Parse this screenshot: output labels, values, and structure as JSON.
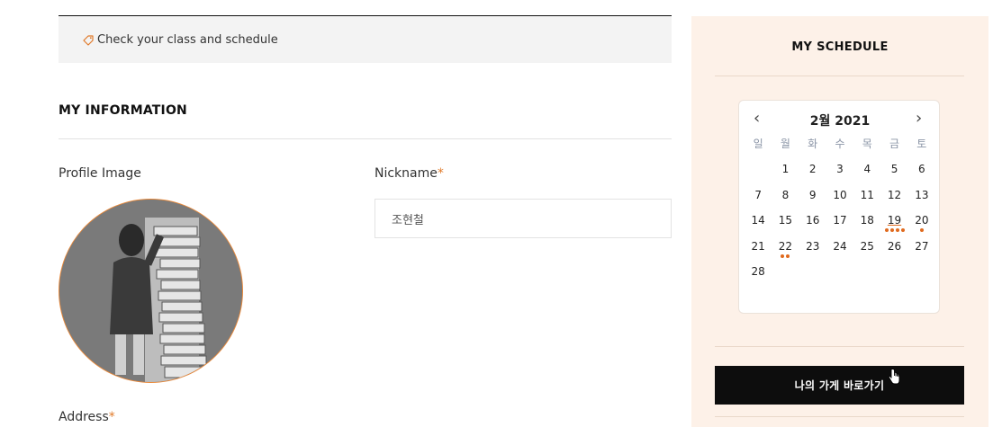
{
  "notice": {
    "text": "Check your class and schedule"
  },
  "my_info": {
    "title": "MY INFORMATION",
    "profile_label": "Profile Image",
    "nickname_label": "Nickname",
    "nickname_required": "*",
    "nickname_value": "조현철",
    "address_label": "Address",
    "address_required": "*"
  },
  "schedule": {
    "title": "MY SCHEDULE",
    "month_label": "2월 2021",
    "weekdays": [
      "일",
      "월",
      "화",
      "수",
      "목",
      "금",
      "토"
    ],
    "weeks": [
      [
        "",
        "1",
        "2",
        "3",
        "4",
        "5",
        "6"
      ],
      [
        "7",
        "8",
        "9",
        "10",
        "11",
        "12",
        "13"
      ],
      [
        "14",
        "15",
        "16",
        "17",
        "18",
        "19",
        "20"
      ],
      [
        "21",
        "22",
        "23",
        "24",
        "25",
        "26",
        "27"
      ],
      [
        "28",
        "",
        "",
        "",
        "",
        "",
        ""
      ]
    ],
    "events": {
      "19": 4,
      "20": 1,
      "22": 2
    },
    "event_color": "#e06a1e",
    "prev_icon": "chevron-left-icon",
    "next_icon": "chevron-right-icon"
  },
  "shop_button": {
    "label": "나의 가게 바로가기"
  },
  "colors": {
    "accent": "#e07a2a",
    "sidebar_bg": "#fdf1e8",
    "button_bg": "#0d0d0d"
  }
}
